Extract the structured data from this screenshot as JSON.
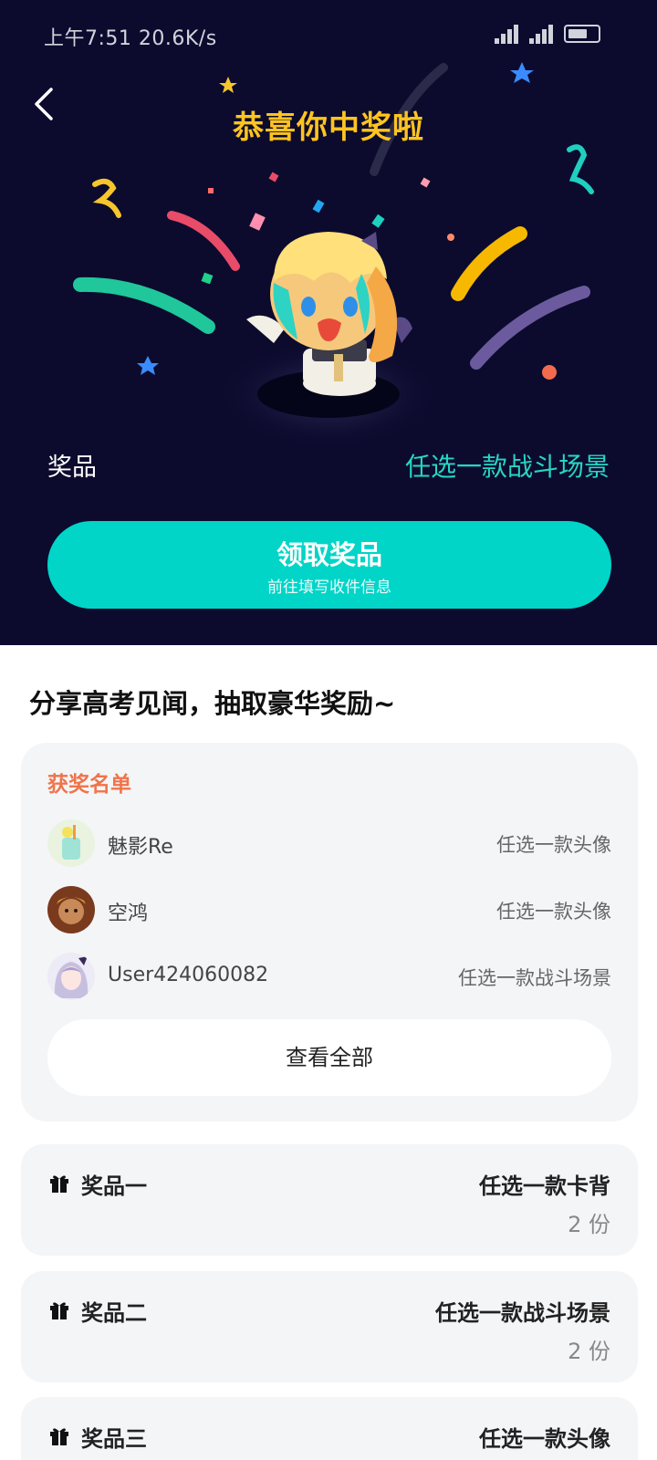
{
  "status": {
    "time": "上午7:51 20.6K/s",
    "battery": "37"
  },
  "hero": {
    "title": "恭喜你中奖啦",
    "prize_label": "奖品",
    "prize_value": "任选一款战斗场景",
    "claim_title": "领取奖品",
    "claim_subtitle": "前往填写收件信息"
  },
  "colors": {
    "hero_bg": "#0c0b2e",
    "title_gold": "#ffc41f",
    "accent_teal": "#00d5c8",
    "heading_orange": "#f0744a"
  },
  "section_title": "分享高考见闻，抽取豪华奖励~",
  "winners": {
    "heading": "获奖名单",
    "rows": [
      {
        "name": "魅影Re",
        "prize": "任选一款头像",
        "avatar_icon": "drink-avatar"
      },
      {
        "name": "空鸿",
        "prize": "任选一款头像",
        "avatar_icon": "warrior-avatar"
      },
      {
        "name": "User424060082",
        "prize": "任选一款战斗场景",
        "avatar_icon": "anime-girl-avatar"
      }
    ],
    "view_all": "查看全部"
  },
  "prizes": [
    {
      "name": "奖品一",
      "desc": "任选一款卡背",
      "qty": "2 份"
    },
    {
      "name": "奖品二",
      "desc": "任选一款战斗场景",
      "qty": "2 份"
    },
    {
      "name": "奖品三",
      "desc": "任选一款头像",
      "qty": ""
    }
  ]
}
